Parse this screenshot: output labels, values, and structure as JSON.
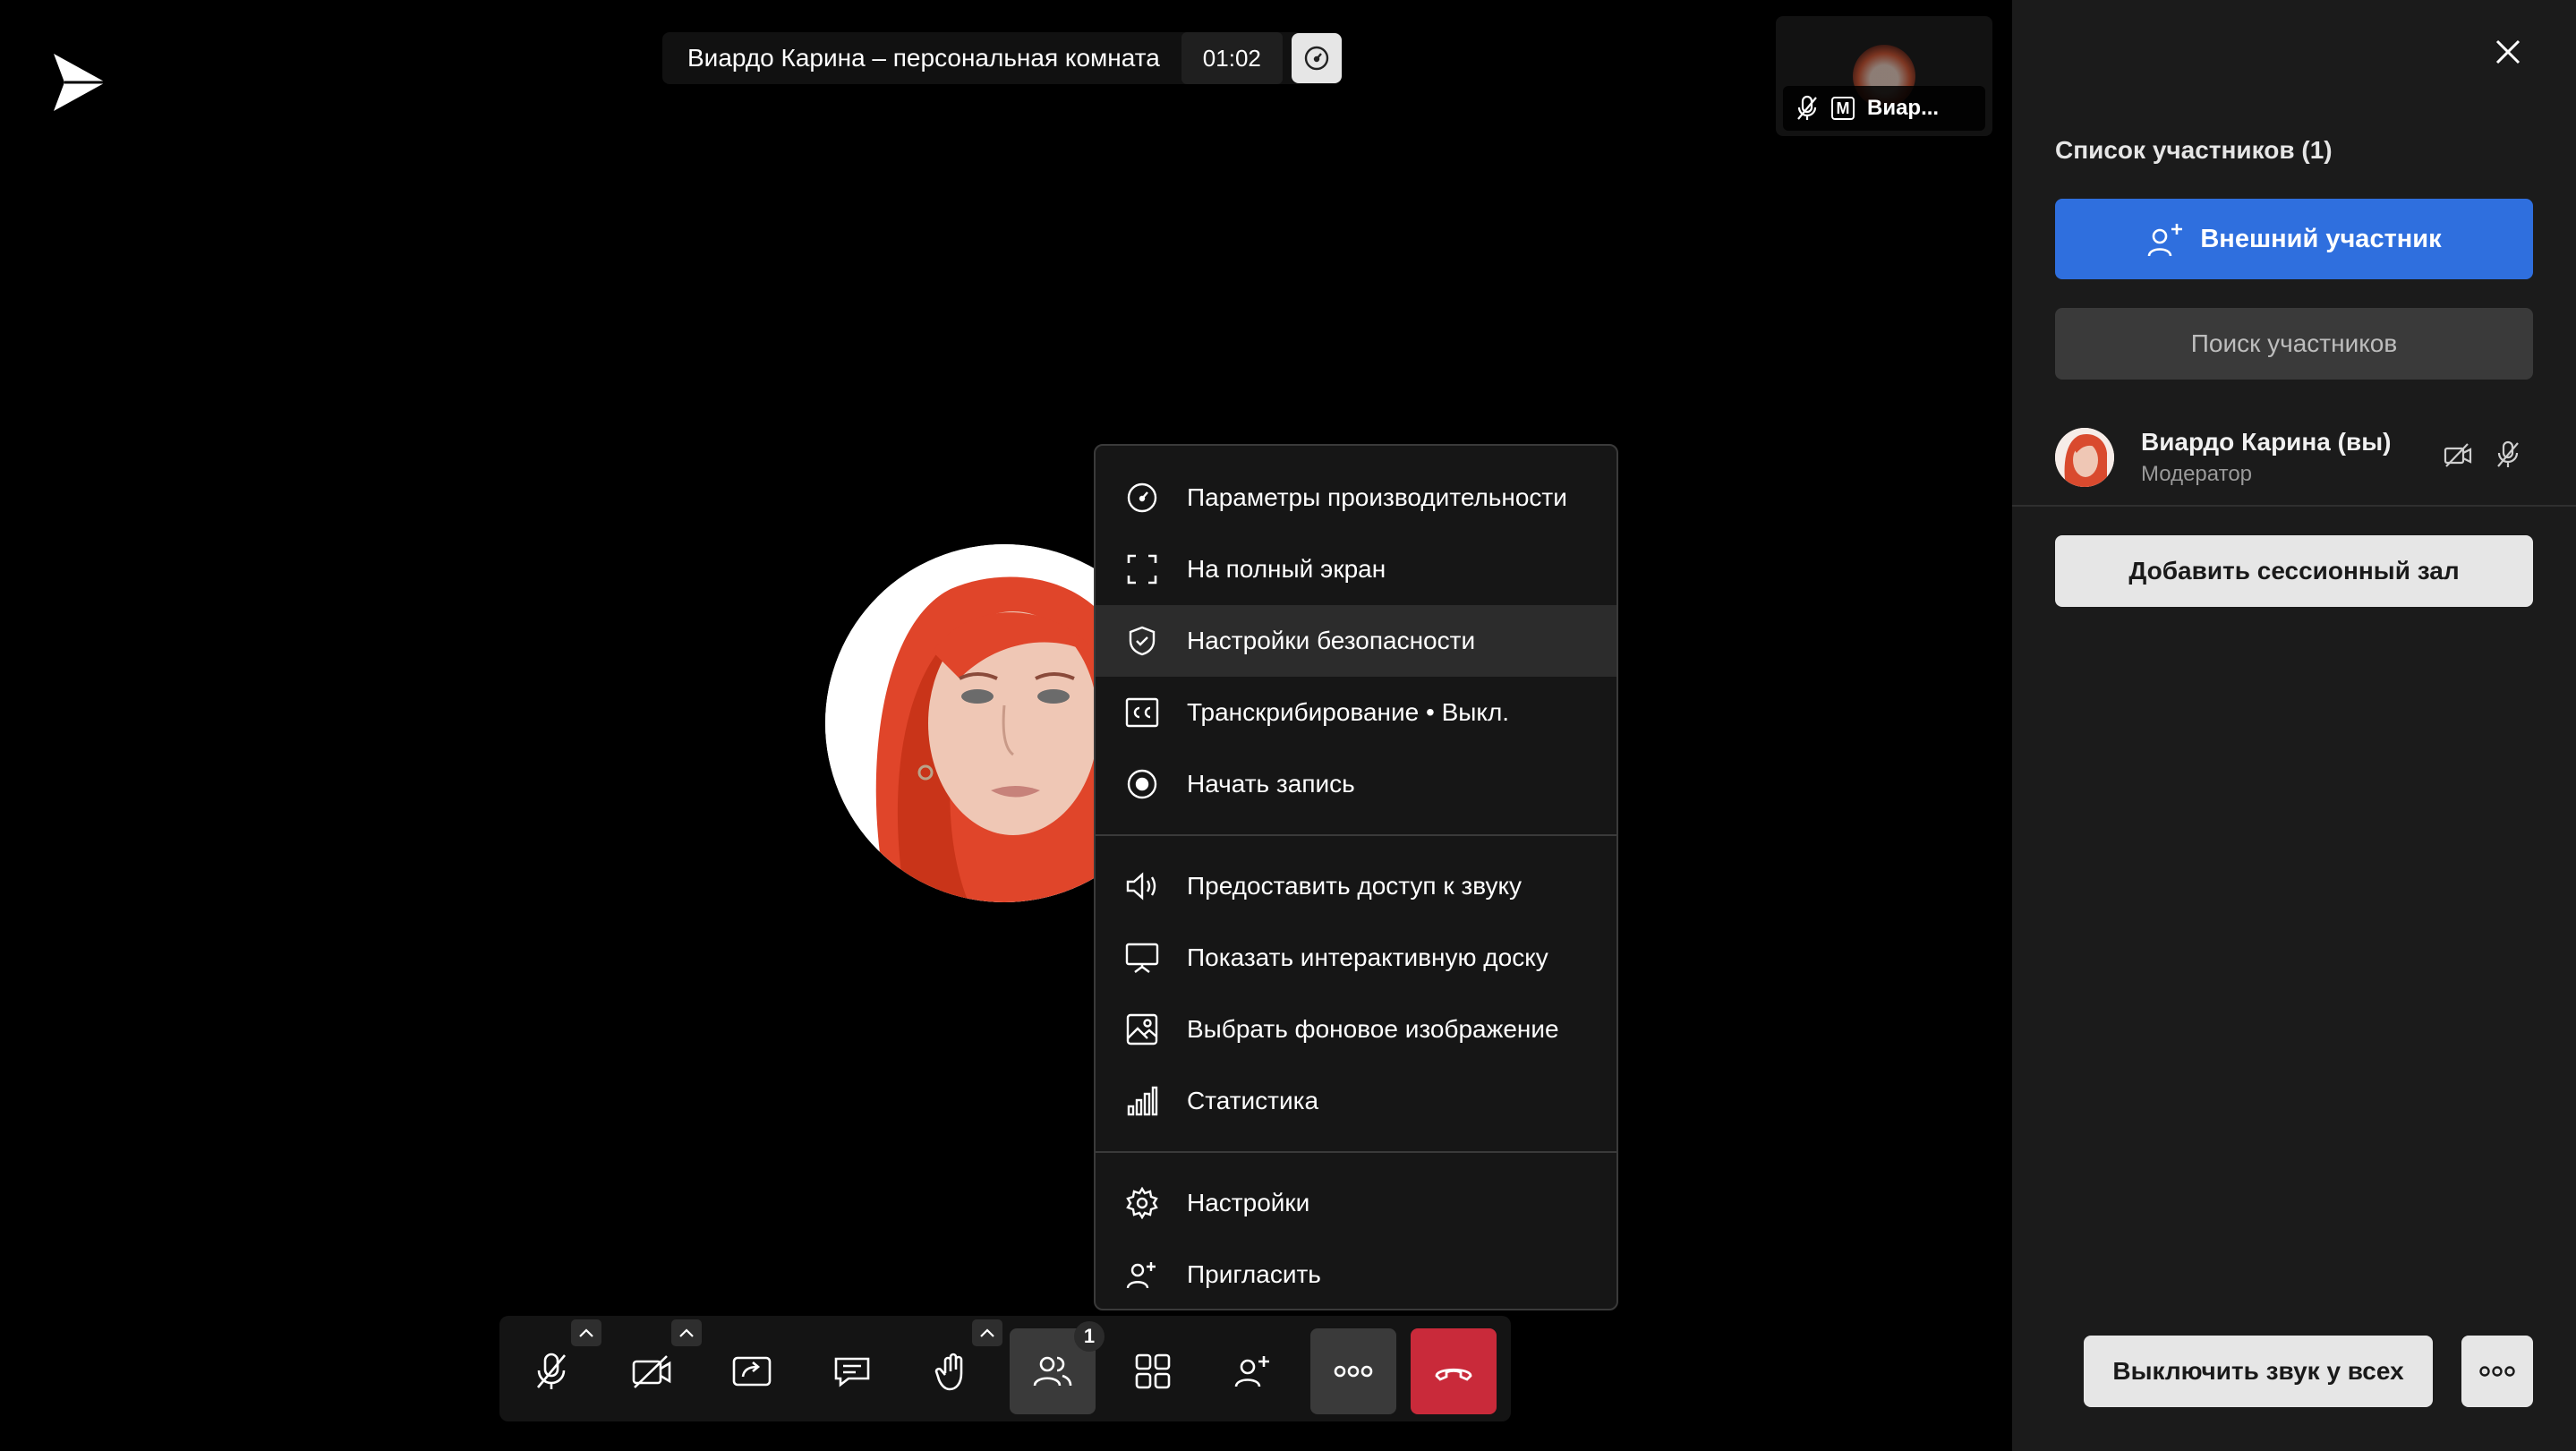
{
  "header": {
    "title": "Виардо Карина – персональная комната",
    "timer": "01:02"
  },
  "thumbnail": {
    "name": "Виар...",
    "moderator_badge": "M"
  },
  "more_menu": {
    "items": [
      {
        "label": "Параметры производительности",
        "icon": "gauge-icon"
      },
      {
        "label": "На полный экран",
        "icon": "fullscreen-icon"
      },
      {
        "label": "Настройки безопасности",
        "icon": "shield-check-icon",
        "highlighted": true
      },
      {
        "label": "Транскрибирование • Выкл.",
        "icon": "closed-captions-icon"
      },
      {
        "label": "Начать запись",
        "icon": "record-icon"
      },
      {
        "label": "Предоставить доступ к звуку",
        "icon": "speaker-icon"
      },
      {
        "label": "Показать интерактивную доску",
        "icon": "whiteboard-icon"
      },
      {
        "label": "Выбрать фоновое изображение",
        "icon": "image-icon"
      },
      {
        "label": "Статистика",
        "icon": "bar-chart-icon"
      },
      {
        "label": "Настройки",
        "icon": "gear-icon"
      },
      {
        "label": "Пригласить",
        "icon": "add-user-icon"
      }
    ]
  },
  "toolbar": {
    "participants_count": "1",
    "buttons": [
      "mic-off-icon",
      "camera-off-icon",
      "share-screen-icon",
      "chat-icon",
      "raise-hand-icon",
      "participants-icon",
      "grid-view-icon",
      "invite-icon",
      "more-icon",
      "hang-up-icon"
    ],
    "colors": {
      "hangup": "#c92a3a",
      "active": "#3a3a3a"
    }
  },
  "panel": {
    "title": "Список участников (1)",
    "external_button": "Внешний участник",
    "search_button": "Поиск участников",
    "participant": {
      "name": "Виардо Карина (вы)",
      "role": "Модератор"
    },
    "breakout_button": "Добавить сессионный зал",
    "mute_all_button": "Выключить звук у всех",
    "accent_color": "#2f6fde"
  }
}
